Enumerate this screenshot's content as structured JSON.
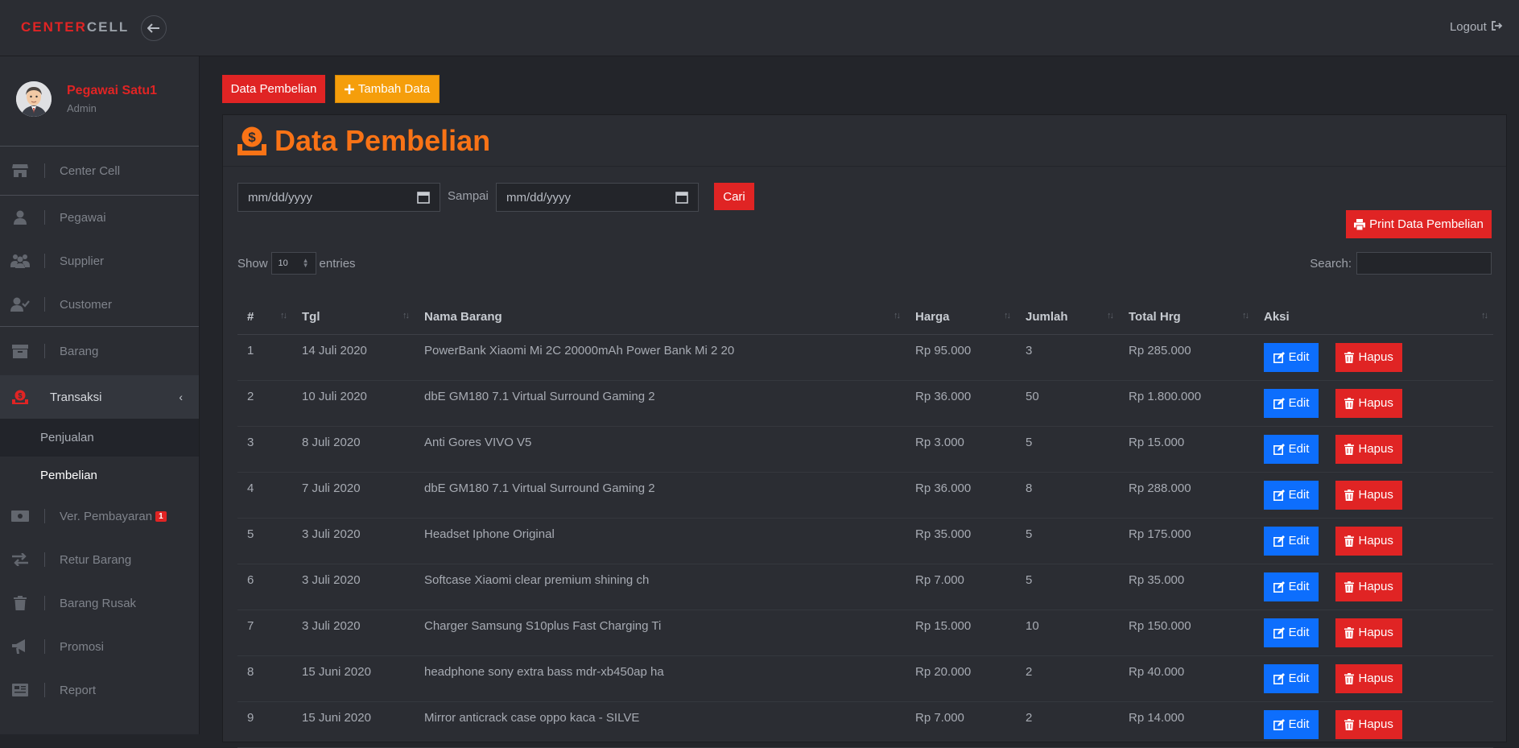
{
  "topbar": {
    "brand_part1": "CENTER",
    "brand_part2": "CELL",
    "back_icon": "arrow-left-icon",
    "logout_label": "Logout"
  },
  "sidebar": {
    "user_name": "Pegawai Satu1",
    "user_role": "Admin",
    "items": [
      {
        "label": "Center Cell",
        "icon": "store-icon"
      },
      {
        "label": "Pegawai",
        "icon": "user-icon"
      },
      {
        "label": "Supplier",
        "icon": "users-icon"
      },
      {
        "label": "Customer",
        "icon": "user-check-icon"
      },
      {
        "label": "Barang",
        "icon": "archive-icon"
      },
      {
        "label": "Transaksi",
        "icon": "money-bag-icon"
      },
      {
        "label": "Ver. Pembayaran",
        "icon": "money-bill-icon",
        "badge": "1"
      },
      {
        "label": "Retur Barang",
        "icon": "exchange-icon"
      },
      {
        "label": "Barang Rusak",
        "icon": "trash-icon"
      },
      {
        "label": "Promosi",
        "icon": "megaphone-icon"
      },
      {
        "label": "Report",
        "icon": "report-icon"
      }
    ],
    "sub_items": [
      {
        "label": "Penjualan"
      },
      {
        "label": "Pembelian"
      }
    ]
  },
  "main": {
    "btn_data_pembelian": "Data Pembelian",
    "btn_tambah": "Tambah Data",
    "panel_title": "Data Pembelian",
    "date_placeholder_from": "mm/dd/yyyy",
    "label_sampai": "Sampai",
    "date_placeholder_to": "mm/dd/yyyy",
    "btn_cari": "Cari",
    "btn_print": "Print Data Pembelian",
    "show_label": "Show",
    "entries_value": "10",
    "entries_label": "entries",
    "search_label": "Search:",
    "search_value": ""
  },
  "table": {
    "columns": [
      "#",
      "Tgl",
      "Nama Barang",
      "Harga",
      "Jumlah",
      "Total Hrg",
      "Aksi"
    ],
    "edit_label": "Edit",
    "hapus_label": "Hapus",
    "rows": [
      {
        "no": "1",
        "tgl": "14 Juli 2020",
        "nama": "PowerBank Xiaomi Mi 2C 20000mAh Power Bank Mi 2 20",
        "harga": "Rp 95.000",
        "jumlah": "3",
        "total": "Rp 285.000"
      },
      {
        "no": "2",
        "tgl": "10 Juli 2020",
        "nama": "dbE GM180 7.1 Virtual Surround Gaming 2",
        "harga": "Rp 36.000",
        "jumlah": "50",
        "total": "Rp 1.800.000"
      },
      {
        "no": "3",
        "tgl": "8 Juli 2020",
        "nama": "Anti Gores VIVO V5",
        "harga": "Rp 3.000",
        "jumlah": "5",
        "total": "Rp 15.000"
      },
      {
        "no": "4",
        "tgl": "7 Juli 2020",
        "nama": "dbE GM180 7.1 Virtual Surround Gaming 2",
        "harga": "Rp 36.000",
        "jumlah": "8",
        "total": "Rp 288.000"
      },
      {
        "no": "5",
        "tgl": "3 Juli 2020",
        "nama": "Headset Iphone Original",
        "harga": "Rp 35.000",
        "jumlah": "5",
        "total": "Rp 175.000"
      },
      {
        "no": "6",
        "tgl": "3 Juli 2020",
        "nama": "Softcase Xiaomi clear premium shining ch",
        "harga": "Rp 7.000",
        "jumlah": "5",
        "total": "Rp 35.000"
      },
      {
        "no": "7",
        "tgl": "3 Juli 2020",
        "nama": "Charger Samsung S10plus Fast Charging Ti",
        "harga": "Rp 15.000",
        "jumlah": "10",
        "total": "Rp 150.000"
      },
      {
        "no": "8",
        "tgl": "15 Juni 2020",
        "nama": "headphone sony extra bass mdr-xb450ap ha",
        "harga": "Rp 20.000",
        "jumlah": "2",
        "total": "Rp 40.000"
      },
      {
        "no": "9",
        "tgl": "15 Juni 2020",
        "nama": "Mirror anticrack case oppo kaca - SILVE",
        "harga": "Rp 7.000",
        "jumlah": "2",
        "total": "Rp 14.000"
      }
    ]
  }
}
